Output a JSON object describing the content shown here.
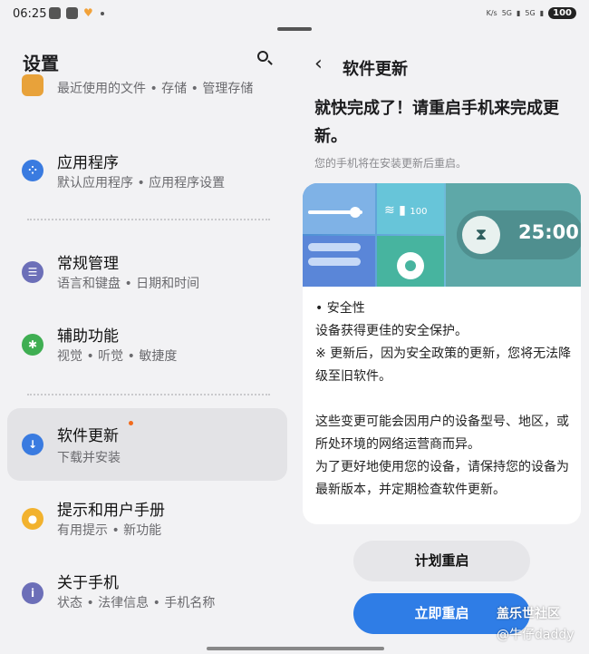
{
  "status_bar": {
    "time": "06:25",
    "battery": "100",
    "network_labels": [
      "K/s",
      "5G",
      "5G"
    ]
  },
  "settings": {
    "title": "设置",
    "items": [
      {
        "sub": "最近使用的文件 • 存储 • 管理存储",
        "icon": "folder-icon",
        "color": "#e8a23a"
      },
      {
        "title": "应用程序",
        "sub": "默认应用程序 • 应用程序设置",
        "icon": "apps-icon",
        "color": "#3a7be0"
      },
      {
        "title": "常规管理",
        "sub": "语言和键盘 • 日期和时间",
        "icon": "sliders-icon",
        "color": "#6c6fb8"
      },
      {
        "title": "辅助功能",
        "sub": "视觉 • 听觉 • 敏捷度",
        "icon": "accessibility-icon",
        "color": "#3fae52"
      },
      {
        "title": "软件更新",
        "sub": "下载并安装",
        "icon": "download-icon",
        "color": "#3a7be0",
        "active": true
      },
      {
        "title": "提示和用户手册",
        "sub": "有用提示 • 新功能",
        "icon": "lightbulb-icon",
        "color": "#f2b22e"
      },
      {
        "title": "关于手机",
        "sub": "状态 • 法律信息 • 手机名称",
        "icon": "info-icon",
        "color": "#6c6fb8"
      }
    ]
  },
  "update": {
    "title": "软件更新",
    "headline": "就快完成了！请重启手机来完成更新。",
    "subline": "您的手机将在安装更新后重启。",
    "banner": {
      "timer": "25:00",
      "battery_label": "100"
    },
    "security_heading": "• 安全性",
    "security_line1": "设备获得更佳的安全保护。",
    "security_line2": "※ 更新后，因为安全政策的更新，您将无法降级至旧软件。",
    "notice_para1": "这些变更可能会因用户的设备型号、地区，或所处环境的网络运营商而异。",
    "notice_para2": "为了更好地使用您的设备，请保持您的设备为最新版本，并定期检查软件更新。",
    "schedule_button": "计划重启",
    "restart_button": "立即重启"
  },
  "watermark": {
    "line1": "盖乐世社区",
    "line2": "@牛仔daddy"
  }
}
